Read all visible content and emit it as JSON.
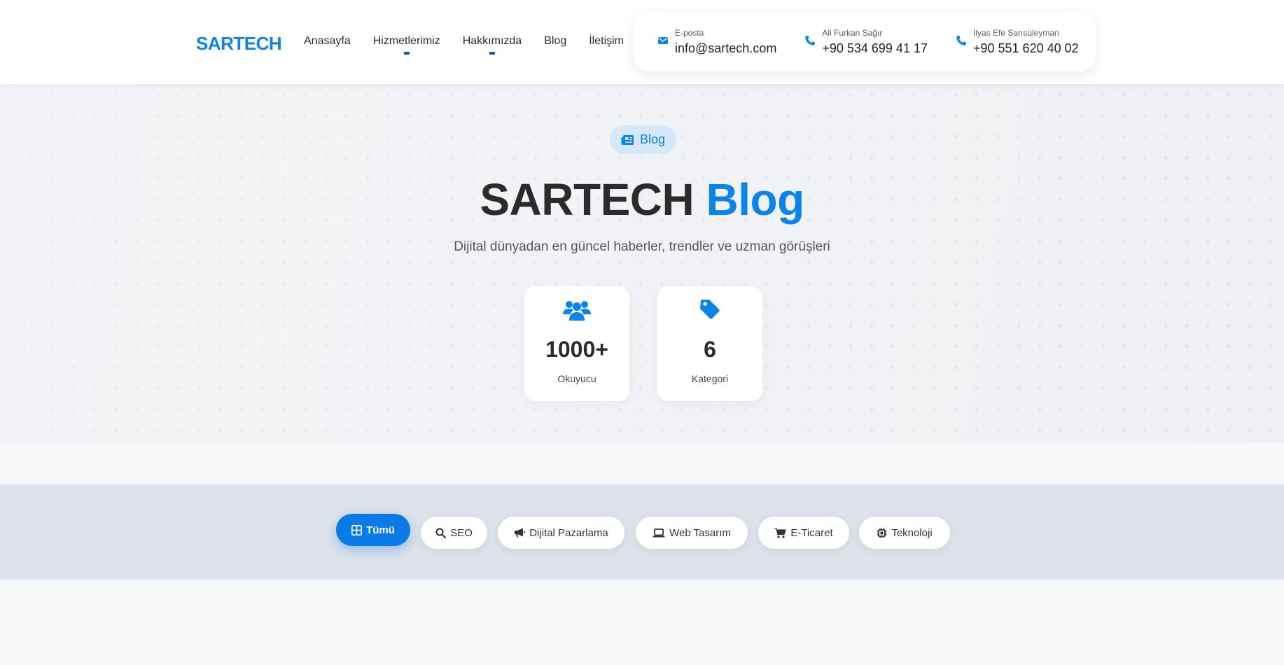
{
  "header": {
    "logo": "SARTECH",
    "nav": [
      {
        "label": "Anasayfa",
        "dropdown": false
      },
      {
        "label": "Hizmetlerimiz",
        "dropdown": true
      },
      {
        "label": "Hakkımızda",
        "dropdown": true
      },
      {
        "label": "Blog",
        "dropdown": false
      },
      {
        "label": "İletişim",
        "dropdown": false
      }
    ],
    "contacts": [
      {
        "label": "E-posta",
        "value": "info@sartech.com",
        "icon": "envelope-icon"
      },
      {
        "label": "Ali Furkan Sağır",
        "value": "+90 534 699 41 17",
        "icon": "phone-icon"
      },
      {
        "label": "İlyas Efe Sarısüleyman",
        "value": "+90 551 620 40 02",
        "icon": "phone-icon"
      }
    ]
  },
  "hero": {
    "badge": "Blog",
    "badge_icon": "newspaper-icon",
    "title_main": "SARTECH",
    "title_accent": "Blog",
    "subtitle": "Dijital dünyadan en güncel haberler, trendler ve uzman görüşleri",
    "stats": [
      {
        "value": "1000+",
        "label": "Okuyucu",
        "icon": "users-icon"
      },
      {
        "value": "6",
        "label": "Kategori",
        "icon": "tag-icon"
      }
    ]
  },
  "filters": [
    {
      "label": "Tümü",
      "icon": "grid-icon",
      "active": true
    },
    {
      "label": "SEO",
      "icon": "search-icon",
      "active": false
    },
    {
      "label": "Dijital Pazarlama",
      "icon": "megaphone-icon",
      "active": false
    },
    {
      "label": "Web Tasarım",
      "icon": "laptop-icon",
      "active": false
    },
    {
      "label": "E-Ticaret",
      "icon": "cart-icon",
      "active": false
    },
    {
      "label": "Teknoloji",
      "icon": "chip-icon",
      "active": false
    }
  ],
  "colors": {
    "accent": "#0a84e8",
    "active_pill": "#0a7ae6",
    "text": "#2b2b2b"
  }
}
